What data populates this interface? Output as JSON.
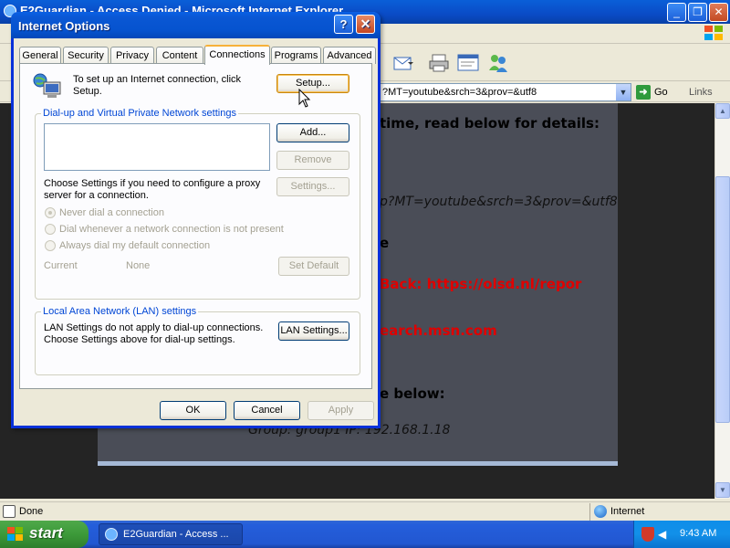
{
  "ie": {
    "title": "E2Guardian - Access Denied - Microsoft Internet Explorer",
    "address": "?MT=youtube&srch=3&prov=&utf8",
    "go_label": "Go",
    "links_label": "Links"
  },
  "page": {
    "line1": "time, read below for details:",
    "line2": "p?MT=youtube&srch=3&prov=&utf8",
    "line3": "e",
    "line4": "Back: https://olsd.nl/repor",
    "line5": "earch.msn.com",
    "line6": "e below:",
    "line7": "Group: group1   IP: 192.168.1.18"
  },
  "status": {
    "text": "Done",
    "zone": "Internet"
  },
  "taskbar": {
    "start_label": "start",
    "task_label": "E2Guardian - Access ...",
    "clock": "9:43 AM"
  },
  "dialog": {
    "title": "Internet Options",
    "help_label": "?",
    "close_label": "✕",
    "tabs": [
      {
        "label": "General"
      },
      {
        "label": "Security"
      },
      {
        "label": "Privacy"
      },
      {
        "label": "Content"
      },
      {
        "label": "Connections"
      },
      {
        "label": "Programs"
      },
      {
        "label": "Advanced"
      }
    ],
    "setup_text": "To set up an Internet connection, click Setup.",
    "setup_line1": "To set up an Internet connection, click",
    "setup_line2": "Setup.",
    "setup_button": "Setup...",
    "dialup_group_title": "Dial-up and Virtual Private Network settings",
    "add_button": "Add...",
    "remove_button": "Remove",
    "settings_button": "Settings...",
    "proxy_text_line1": "Choose Settings if you need to configure a proxy",
    "proxy_text_line2": "server for a connection.",
    "radio_never": "Never dial a connection",
    "radio_whenever": "Dial whenever a network connection is not present",
    "radio_always": "Always dial my default connection",
    "current_label": "Current",
    "current_value": "None",
    "set_default_button": "Set Default",
    "lan_group_title": "Local Area Network (LAN) settings",
    "lan_text_line1": "LAN Settings do not apply to dial-up connections.",
    "lan_text_line2": "Choose Settings above for dial-up settings.",
    "lan_settings_button": "LAN Settings...",
    "ok_button": "OK",
    "cancel_button": "Cancel",
    "apply_button": "Apply"
  },
  "colors": {
    "accent_blue": "#0a57d4",
    "group_title_blue": "#0046d5",
    "page_red": "#e00000",
    "page_panel": "#4a4d57"
  }
}
